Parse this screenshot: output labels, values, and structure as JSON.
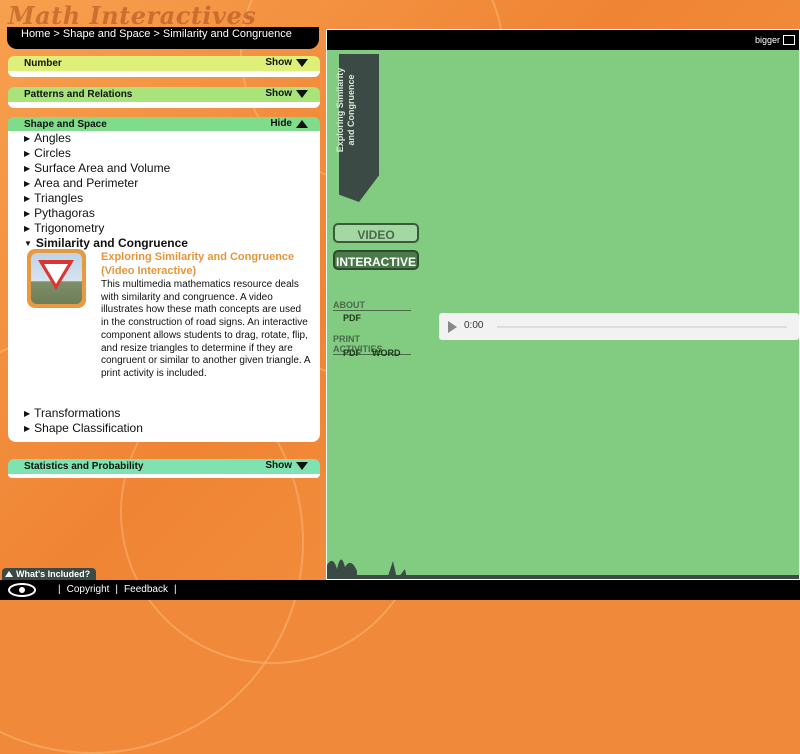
{
  "logo": "Math Interactives",
  "breadcrumb": "Home > Shape and Space > Similarity and Congruence",
  "sections": {
    "number": {
      "title": "Number",
      "toggle": "Show",
      "color": "#dff07a"
    },
    "patterns": {
      "title": "Patterns and Relations",
      "toggle": "Show",
      "color": "#a8e47a"
    },
    "shape": {
      "title": "Shape and Space",
      "toggle": "Hide",
      "color": "#7edc8a"
    },
    "stats": {
      "title": "Statistics and Probability",
      "toggle": "Show",
      "color": "#7ee3b0"
    }
  },
  "topics": [
    "Angles",
    "Circles",
    "Surface Area and Volume",
    "Area and Perimeter",
    "Triangles",
    "Pythagoras",
    "Trigonometry",
    "Similarity and Congruence",
    "Transformations",
    "Shape Classification"
  ],
  "resource": {
    "title": "Exploring Similarity and Congruence (Video Interactive)",
    "description": "This multimedia mathematics resource deals with similarity and congruence. A video illustrates how these math concepts are used in the construction of road signs. An interactive component allows students to drag, rotate, flip, and resize triangles to determine if they are congruent or similar to another given triangle. A print activity is included."
  },
  "player": {
    "bigger": "bigger",
    "ribbon_title": "Exploring Similarity and Congruence",
    "video_label": "VIDEO",
    "interactive_label": "INTERACTIVE",
    "about_label": "ABOUT",
    "about_pdf": "PDF",
    "print_label": "PRINT ACTIVITIES",
    "print_pdf": "PDF",
    "print_word": "WORD",
    "audio_time": "0:00"
  },
  "footer": {
    "whats_included": "What's Included?",
    "sep1": "|",
    "copyright": "Copyright",
    "sep2": "|",
    "feedback": "Feedback",
    "sep3": "|"
  }
}
